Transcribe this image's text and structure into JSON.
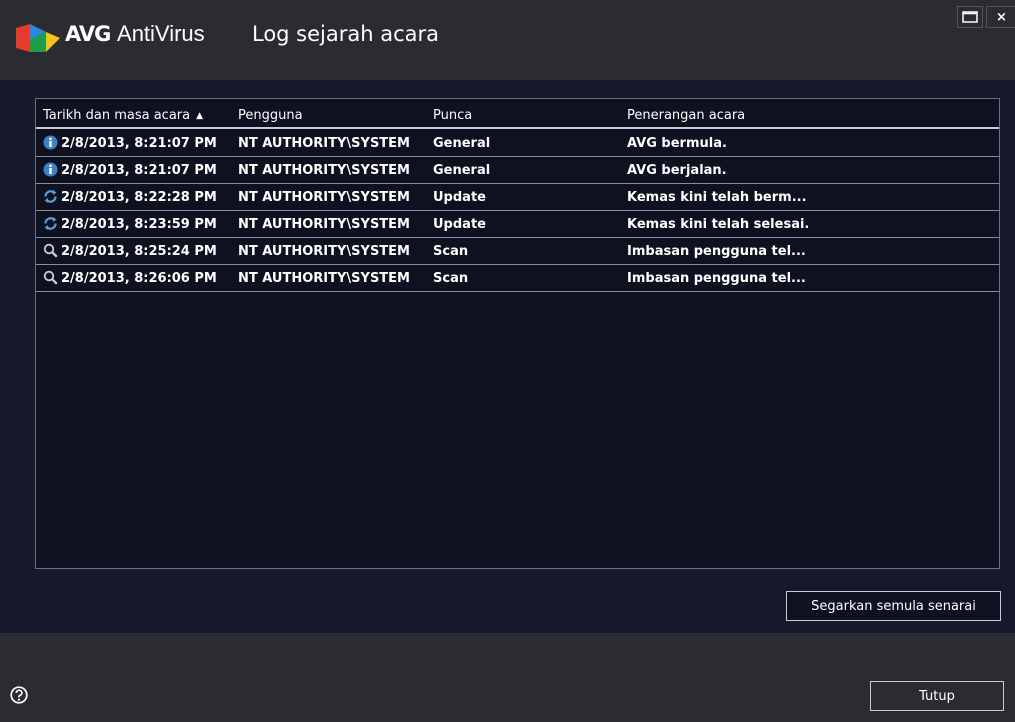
{
  "app": {
    "brand_bold": "AVG",
    "brand_light": "AntiVirus",
    "title": "Log sejarah acara"
  },
  "window_controls": {
    "maximize_icon": "window-icon",
    "close_label": "×"
  },
  "table": {
    "columns": [
      {
        "label": "Tarikh dan masa acara",
        "sorted": "ascending"
      },
      {
        "label": "Pengguna"
      },
      {
        "label": "Punca"
      },
      {
        "label": "Penerangan acara"
      }
    ],
    "rows": [
      {
        "icon": "info-icon",
        "datetime": "2/8/2013, 8:21:07 PM",
        "user": "NT AUTHORITY\\SYSTEM",
        "source": "General",
        "description": "AVG bermula."
      },
      {
        "icon": "info-icon",
        "datetime": "2/8/2013, 8:21:07 PM",
        "user": "NT AUTHORITY\\SYSTEM",
        "source": "General",
        "description": "AVG berjalan."
      },
      {
        "icon": "update-icon",
        "datetime": "2/8/2013, 8:22:28 PM",
        "user": "NT AUTHORITY\\SYSTEM",
        "source": "Update",
        "description": "Kemas kini telah berm..."
      },
      {
        "icon": "update-icon",
        "datetime": "2/8/2013, 8:23:59 PM",
        "user": "NT AUTHORITY\\SYSTEM",
        "source": "Update",
        "description": "Kemas kini telah selesai."
      },
      {
        "icon": "scan-icon",
        "datetime": "2/8/2013, 8:25:24 PM",
        "user": "NT AUTHORITY\\SYSTEM",
        "source": "Scan",
        "description": "Imbasan pengguna tel..."
      },
      {
        "icon": "scan-icon",
        "datetime": "2/8/2013, 8:26:06 PM",
        "user": "NT AUTHORITY\\SYSTEM",
        "source": "Scan",
        "description": "Imbasan pengguna tel..."
      }
    ]
  },
  "buttons": {
    "refresh_label": "Segarkan semula senarai",
    "close_label": "Tutup"
  },
  "colors": {
    "titlebar_bg": "#2b2c32",
    "content_bg": "#16192b",
    "info_icon": "#3d82c4"
  }
}
